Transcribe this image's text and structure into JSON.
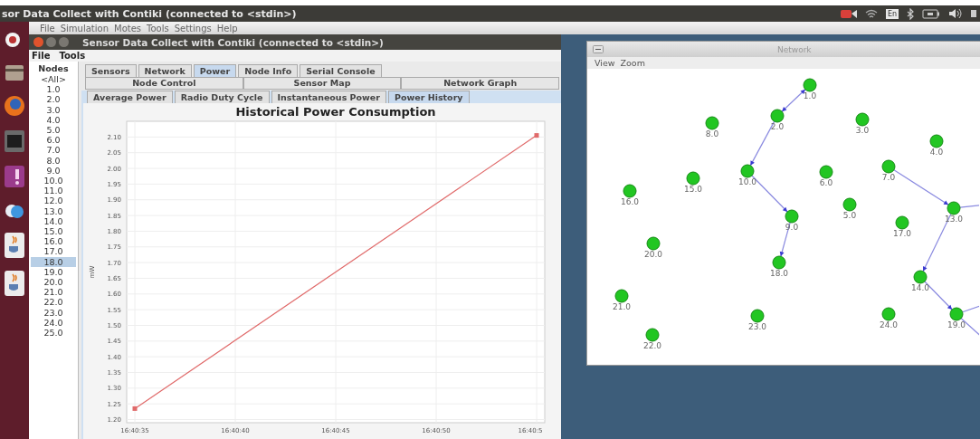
{
  "top_bar": {
    "title": "sor Data Collect with Contiki (connected to <stdin>)",
    "keyboard_layout": "En"
  },
  "app_menu": [
    "File",
    "Simulation",
    "Motes",
    "Tools",
    "Settings",
    "Help"
  ],
  "window": {
    "title": "Sensor Data Collect with Contiki (connected to <stdin>)",
    "menu": [
      "File",
      "Tools"
    ]
  },
  "nodes": {
    "header": "Nodes",
    "items": [
      {
        "label": "<All>",
        "selected": false
      },
      {
        "label": "1.0",
        "selected": false
      },
      {
        "label": "2.0",
        "selected": false
      },
      {
        "label": "3.0",
        "selected": false
      },
      {
        "label": "4.0",
        "selected": false
      },
      {
        "label": "5.0",
        "selected": false
      },
      {
        "label": "6.0",
        "selected": false
      },
      {
        "label": "7.0",
        "selected": false
      },
      {
        "label": "8.0",
        "selected": false
      },
      {
        "label": "9.0",
        "selected": false
      },
      {
        "label": "10.0",
        "selected": false
      },
      {
        "label": "11.0",
        "selected": false
      },
      {
        "label": "12.0",
        "selected": false
      },
      {
        "label": "13.0",
        "selected": false
      },
      {
        "label": "14.0",
        "selected": false
      },
      {
        "label": "15.0",
        "selected": false
      },
      {
        "label": "16.0",
        "selected": false
      },
      {
        "label": "17.0",
        "selected": false
      },
      {
        "label": "18.0",
        "selected": true
      },
      {
        "label": "19.0",
        "selected": false
      },
      {
        "label": "20.0",
        "selected": false
      },
      {
        "label": "21.0",
        "selected": false
      },
      {
        "label": "22.0",
        "selected": false
      },
      {
        "label": "23.0",
        "selected": false
      },
      {
        "label": "24.0",
        "selected": false
      },
      {
        "label": "25.0",
        "selected": false
      }
    ]
  },
  "tabs": [
    {
      "label": "Sensors",
      "selected": false
    },
    {
      "label": "Network",
      "selected": false
    },
    {
      "label": "Power",
      "selected": true
    },
    {
      "label": "Node Info",
      "selected": false
    },
    {
      "label": "Serial Console",
      "selected": false
    }
  ],
  "tabs_row2": [
    {
      "label": "Node Control",
      "selected": false
    },
    {
      "label": "Sensor Map",
      "selected": false
    },
    {
      "label": "Network Graph",
      "selected": false
    }
  ],
  "power_tabs": [
    {
      "label": "Average Power",
      "selected": false
    },
    {
      "label": "Radio Duty Cycle",
      "selected": false
    },
    {
      "label": "Instantaneous Power",
      "selected": false
    },
    {
      "label": "Power History",
      "selected": true
    }
  ],
  "chart": {
    "chart_data": {
      "type": "line",
      "title": "Historical Power Consumption",
      "ylabel": "mW",
      "categories": [
        "16:40:35",
        "16:40:40",
        "16:40:45",
        "16:40:50",
        "16:40:5"
      ],
      "series": [
        {
          "color": "#e06a6a",
          "marker": "square",
          "values": [
            1.235,
            null,
            null,
            null,
            2.105
          ]
        }
      ],
      "ylim": [
        1.19,
        2.15
      ],
      "grid": true,
      "yticks": [
        {
          "value": 1.2,
          "label": "1.20"
        },
        {
          "value": 1.25,
          "label": "1.25"
        },
        {
          "value": 1.3,
          "label": "1.30"
        },
        {
          "value": 1.35,
          "label": "1.35"
        },
        {
          "value": 1.4,
          "label": "1.40"
        },
        {
          "value": 1.45,
          "label": "1.45"
        },
        {
          "value": 1.5,
          "label": "1.50"
        },
        {
          "value": 1.55,
          "label": "1.55"
        },
        {
          "value": 1.6,
          "label": "1.60"
        },
        {
          "value": 1.65,
          "label": "1.65"
        },
        {
          "value": 1.7,
          "label": "1.70"
        },
        {
          "value": 1.75,
          "label": "1.75"
        },
        {
          "value": 1.8,
          "label": "1.80"
        },
        {
          "value": 1.85,
          "label": "1.85"
        },
        {
          "value": 1.9,
          "label": "1.90"
        },
        {
          "value": 1.95,
          "label": "1.95"
        },
        {
          "value": 2.0,
          "label": "2.00"
        },
        {
          "value": 2.05,
          "label": "2.05"
        },
        {
          "value": 2.1,
          "label": "2.10"
        }
      ]
    }
  },
  "network": {
    "title": "Network",
    "menu": [
      "View",
      "Zoom"
    ],
    "nodes": [
      {
        "label": "1.0"
      },
      {
        "label": "2.0"
      },
      {
        "label": "3.0"
      },
      {
        "label": "4.0"
      },
      {
        "label": "5.0"
      },
      {
        "label": "6.0"
      },
      {
        "label": "7.0"
      },
      {
        "label": "8.0"
      },
      {
        "label": "9.0"
      },
      {
        "label": "10.0"
      },
      {
        "label": "13.0"
      },
      {
        "label": "14.0"
      },
      {
        "label": "15.0"
      },
      {
        "label": "16.0"
      },
      {
        "label": "17.0"
      },
      {
        "label": "18.0"
      },
      {
        "label": "19.0"
      },
      {
        "label": "20.0"
      },
      {
        "label": "21.0"
      },
      {
        "label": "22.0"
      },
      {
        "label": "23.0"
      },
      {
        "label": "24.0"
      }
    ]
  }
}
